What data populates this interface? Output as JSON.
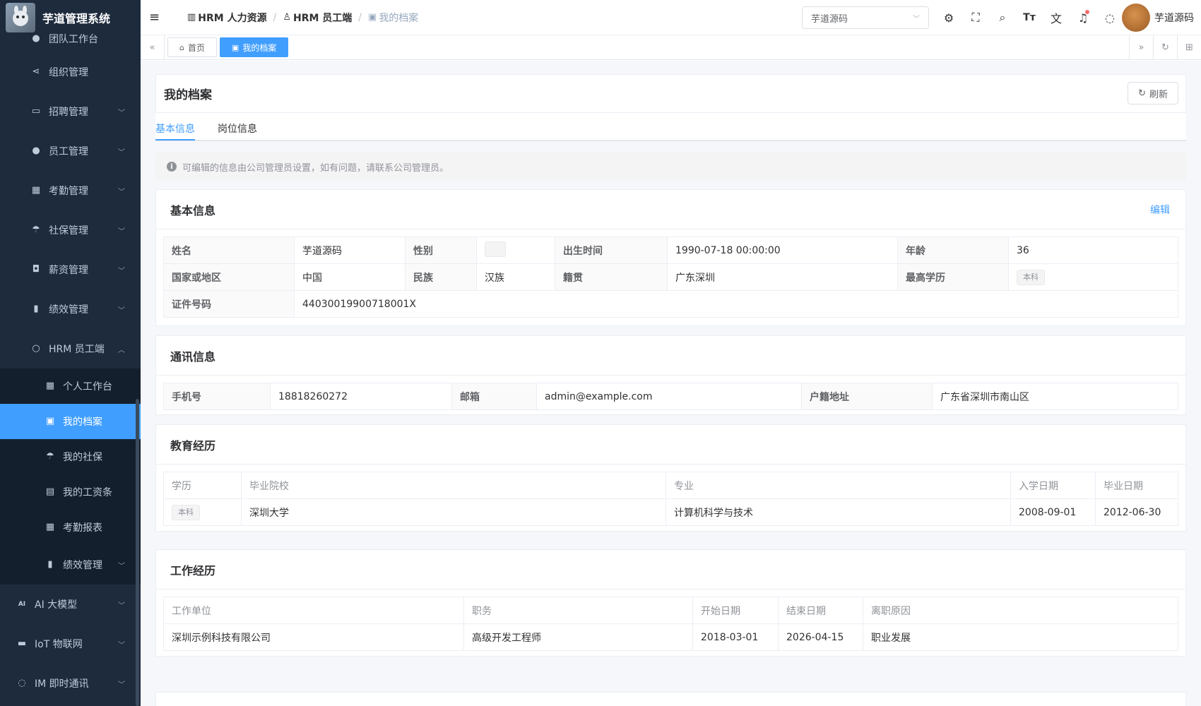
{
  "app": {
    "title": "芋道管理系统"
  },
  "sidebar": {
    "items": [
      {
        "label": "团队工作台",
        "icon": "user-icon"
      },
      {
        "label": "组织管理",
        "icon": "share-icon"
      },
      {
        "label": "招聘管理",
        "icon": "briefcase-icon"
      },
      {
        "label": "员工管理",
        "icon": "user-icon"
      },
      {
        "label": "考勤管理",
        "icon": "calendar-icon"
      },
      {
        "label": "社保管理",
        "icon": "umbrella-icon"
      },
      {
        "label": "薪资管理",
        "icon": "money-icon"
      },
      {
        "label": "绩效管理",
        "icon": "bar-chart-icon"
      },
      {
        "label": "HRM 员工端",
        "icon": "person-icon"
      }
    ],
    "sub_items": [
      {
        "label": "个人工作台",
        "icon": "calendar-icon"
      },
      {
        "label": "我的档案",
        "icon": "file-icon"
      },
      {
        "label": "我的社保",
        "icon": "umbrella-icon"
      },
      {
        "label": "我的工资条",
        "icon": "receipt-icon"
      },
      {
        "label": "考勤报表",
        "icon": "calendar-icon"
      },
      {
        "label": "绩效管理",
        "icon": "bar-chart-icon"
      }
    ],
    "bottom_items": [
      {
        "label": "AI 大模型",
        "icon": "ai-icon"
      },
      {
        "label": "IoT 物联网",
        "icon": "car-icon"
      },
      {
        "label": "IM 即时通讯",
        "icon": "chat-icon"
      }
    ]
  },
  "header": {
    "breadcrumb": [
      "HRM 人力资源",
      "HRM 员工端",
      "我的档案"
    ],
    "tenant": "芋道源码",
    "user_name": "芋道源码"
  },
  "tags": {
    "home": "首页",
    "current": "我的档案"
  },
  "page": {
    "title": "我的档案",
    "refresh": "刷新",
    "tabs": [
      "基本信息",
      "岗位信息"
    ],
    "alert": "可编辑的信息由公司管理员设置，如有问题，请联系公司管理员。"
  },
  "basic": {
    "title": "基本信息",
    "edit": "编辑",
    "name_label": "姓名",
    "name": "芋道源码",
    "gender_label": "性别",
    "birth_label": "出生时间",
    "birth": "1990-07-18 00:00:00",
    "age_label": "年龄",
    "age": "36",
    "country_label": "国家或地区",
    "country": "中国",
    "ethnic_label": "民族",
    "ethnic": "汉族",
    "native_label": "籍贯",
    "native": "广东深圳",
    "edu_label": "最高学历",
    "edu": "本科",
    "id_label": "证件号码",
    "id": "44030019900718001X"
  },
  "contact": {
    "title": "通讯信息",
    "phone_label": "手机号",
    "phone": "18818260272",
    "email_label": "邮箱",
    "email": "admin@example.com",
    "addr_label": "户籍地址",
    "addr": "广东省深圳市南山区"
  },
  "education": {
    "title": "教育经历",
    "headers": [
      "学历",
      "毕业院校",
      "专业",
      "入学日期",
      "毕业日期"
    ],
    "rows": [
      {
        "degree": "本科",
        "school": "深圳大学",
        "major": "计算机科学与技术",
        "start": "2008-09-01",
        "end": "2012-06-30"
      }
    ]
  },
  "work": {
    "title": "工作经历",
    "headers": [
      "工作单位",
      "职务",
      "开始日期",
      "结束日期",
      "离职原因"
    ],
    "rows": [
      {
        "company": "深圳示例科技有限公司",
        "position": "高级开发工程师",
        "start": "2018-03-01",
        "end": "2026-04-15",
        "reason": "职业发展"
      }
    ]
  }
}
